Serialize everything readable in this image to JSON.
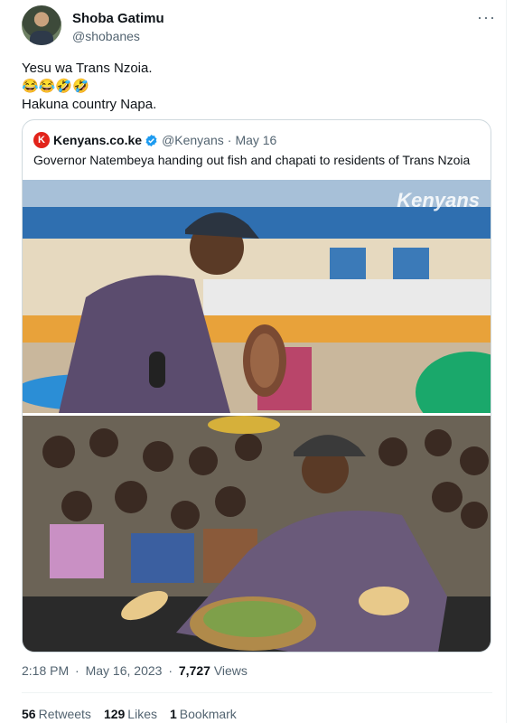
{
  "author": {
    "name": "Shoba Gatimu",
    "handle": "@shobanes"
  },
  "tweet": {
    "line1": "Yesu wa Trans Nzoia.",
    "emojis": "😂😂🤣🤣",
    "line3": "Hakuna country Napa."
  },
  "quoted": {
    "logo_letter": "K",
    "name": "Kenyans.co.ke",
    "handle": "@Kenyans",
    "separator": "·",
    "date": "May 16",
    "text": "Governor Natembeya handing out fish and chapati to residents of Trans Nzoia",
    "watermark": "Kenyans"
  },
  "meta": {
    "time": "2:18 PM",
    "dot1": "·",
    "date": "May 16, 2023",
    "dot2": "·",
    "views_count": "7,727",
    "views_label": "Views"
  },
  "stats": {
    "retweets_count": "56",
    "retweets_label": "Retweets",
    "likes_count": "129",
    "likes_label": "Likes",
    "bookmarks_count": "1",
    "bookmarks_label": "Bookmark"
  },
  "colors": {
    "brand_red": "#e2231a",
    "verified_blue": "#1d9bf0",
    "muted": "#536471"
  }
}
